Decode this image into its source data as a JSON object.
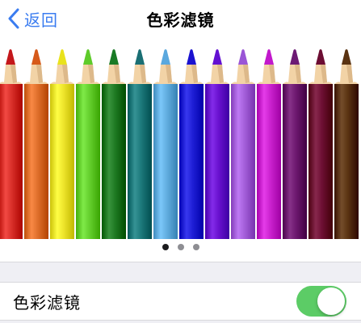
{
  "navbar": {
    "back_label": "返回",
    "title": "色彩滤镜"
  },
  "icons": {
    "back": "chevron-left-icon"
  },
  "pencils": [
    {
      "name": "red",
      "color": "#d9302a",
      "tip": "#c4171b"
    },
    {
      "name": "orange",
      "color": "#e0702c",
      "tip": "#d65a1a"
    },
    {
      "name": "yellow",
      "color": "#eee52c",
      "tip": "#e9e21c"
    },
    {
      "name": "light-green",
      "color": "#66d12f",
      "tip": "#5ecb2a"
    },
    {
      "name": "dark-green",
      "color": "#1f7a23",
      "tip": "#197a25"
    },
    {
      "name": "teal",
      "color": "#1d7a7c",
      "tip": "#1a6f74"
    },
    {
      "name": "sky-blue",
      "color": "#62aee0",
      "tip": "#5aa8de"
    },
    {
      "name": "blue",
      "color": "#1f1fd6",
      "tip": "#1a12d0"
    },
    {
      "name": "violet",
      "color": "#6a12d0",
      "tip": "#6310d2"
    },
    {
      "name": "lavender",
      "color": "#a560db",
      "tip": "#9a55d6"
    },
    {
      "name": "magenta",
      "color": "#cc23d0",
      "tip": "#c218cc"
    },
    {
      "name": "purple",
      "color": "#6d186f",
      "tip": "#6d1a74"
    },
    {
      "name": "maroon",
      "color": "#6e0f34",
      "tip": "#6c0d33"
    },
    {
      "name": "brown",
      "color": "#5b3412",
      "tip": "#5a3312"
    }
  ],
  "pager": {
    "count": 3,
    "active_index": 0
  },
  "setting": {
    "label": "色彩滤镜",
    "enabled": true,
    "accent_color": "#5ccc66"
  },
  "colors": {
    "accent": "#3a7cf0",
    "background": "#efeff4"
  }
}
